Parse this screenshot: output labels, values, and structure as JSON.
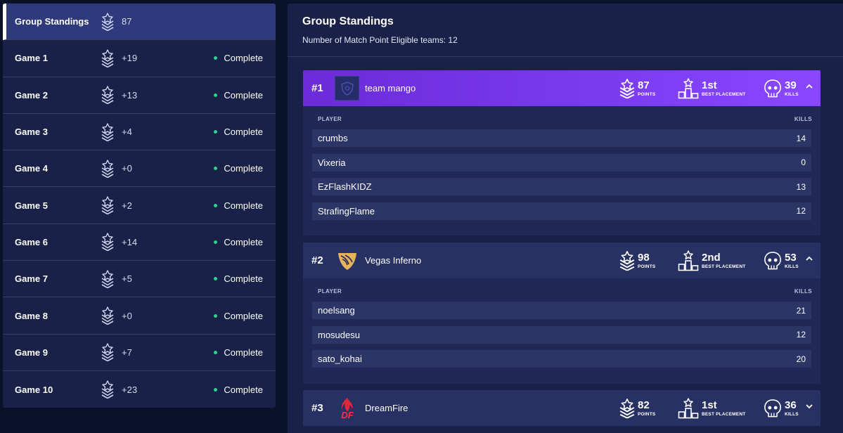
{
  "sidebar": {
    "rows": [
      {
        "name": "Group Standings",
        "points": "87",
        "status": "",
        "active": true
      },
      {
        "name": "Game 1",
        "points": "+19",
        "status": "Complete"
      },
      {
        "name": "Game 2",
        "points": "+13",
        "status": "Complete"
      },
      {
        "name": "Game 3",
        "points": "+4",
        "status": "Complete"
      },
      {
        "name": "Game 4",
        "points": "+0",
        "status": "Complete"
      },
      {
        "name": "Game 5",
        "points": "+2",
        "status": "Complete"
      },
      {
        "name": "Game 6",
        "points": "+14",
        "status": "Complete"
      },
      {
        "name": "Game 7",
        "points": "+5",
        "status": "Complete"
      },
      {
        "name": "Game 8",
        "points": "+0",
        "status": "Complete"
      },
      {
        "name": "Game 9",
        "points": "+7",
        "status": "Complete"
      },
      {
        "name": "Game 10",
        "points": "+23",
        "status": "Complete"
      }
    ]
  },
  "panel": {
    "title": "Group Standings",
    "subtitle": "Number of Match Point Eligible teams: 12"
  },
  "labels": {
    "points": "POINTS",
    "best_placement": "BEST PLACEMENT",
    "kills": "KILLS",
    "player_col": "PLAYER",
    "kills_col": "KILLS"
  },
  "teams": [
    {
      "rank": "#1",
      "name": "team mango",
      "points": "87",
      "best_placement": "1st",
      "kills": "39",
      "expanded": true,
      "players": [
        {
          "name": "crumbs",
          "kills": "14"
        },
        {
          "name": "Vixeria",
          "kills": "0"
        },
        {
          "name": "EzFlashKIDZ",
          "kills": "13"
        },
        {
          "name": "StrafingFlame",
          "kills": "12"
        }
      ]
    },
    {
      "rank": "#2",
      "name": "Vegas Inferno",
      "points": "98",
      "best_placement": "2nd",
      "kills": "53",
      "expanded": true,
      "players": [
        {
          "name": "noelsang",
          "kills": "21"
        },
        {
          "name": "mosudesu",
          "kills": "12"
        },
        {
          "name": "sato_kohai",
          "kills": "20"
        }
      ]
    },
    {
      "rank": "#3",
      "name": "DreamFire",
      "points": "82",
      "best_placement": "1st",
      "kills": "36",
      "expanded": false,
      "players": []
    }
  ],
  "icons": {
    "rank": "rank-chevron-icon",
    "placement": "podium-icon",
    "kills": "skull-icon",
    "expand": "chevron-up-icon",
    "collapse": "chevron-down-icon"
  },
  "colors": {
    "background": "#0b1128",
    "panel": "#1a2148",
    "active_row": "#2e3a7c",
    "first_place": "#7b3cf0",
    "status_dot": "#2bd38b"
  }
}
